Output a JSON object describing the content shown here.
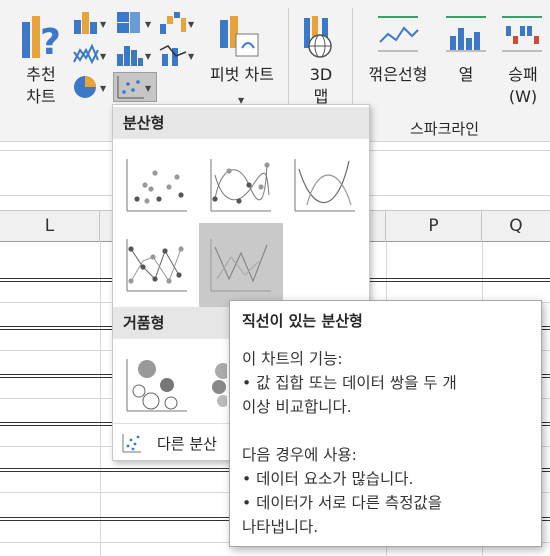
{
  "ribbon": {
    "recommended_charts": {
      "line1": "추천",
      "line2": "차트"
    },
    "pivot_chart": {
      "label": "피벗 차트"
    },
    "map3d": {
      "line1": "3D",
      "line2": "맵"
    },
    "sparkline_group_label": "스파크라인",
    "sparkline_line": {
      "label": "꺾은선형"
    },
    "sparkline_column": {
      "label": "열"
    },
    "sparkline_winloss": {
      "line1": "승패",
      "line2": "(W)"
    }
  },
  "gallery": {
    "scatter_section": "분산형",
    "bubble_section": "거품형",
    "more_label": "다른 분산형 차트(M)...",
    "more_visible": "다른 분산"
  },
  "columns": {
    "L": "L",
    "P": "P",
    "Q": "Q"
  },
  "tooltip": {
    "title": "직선이 있는 분산형",
    "purpose_heading": "이 차트의 기능:",
    "purpose_1": "• 값 집합 또는 데이터 쌍을 두 개",
    "purpose_2": "이상 비교합니다.",
    "use_heading": "다음 경우에 사용:",
    "use_1": "• 데이터 요소가 많습니다.",
    "use_2": "• 데이터가 서로 다른 측정값을",
    "use_3": "나타냅니다."
  },
  "colors": {
    "accent_orange": "#e8a33b",
    "accent_blue": "#3c78c8",
    "ribbon_bg": "#f3f3f3",
    "selection_gray": "#c9c9c9"
  }
}
